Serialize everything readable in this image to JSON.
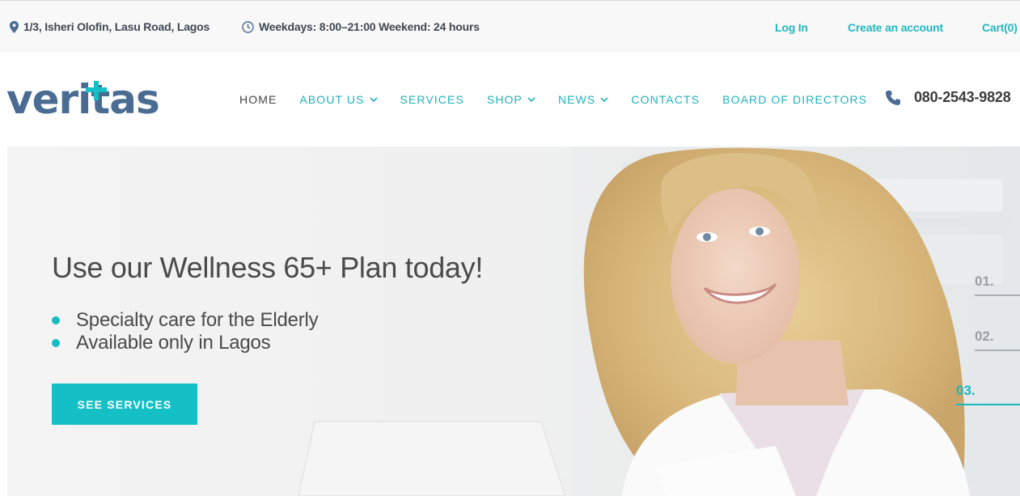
{
  "topbar": {
    "address": "1/3, Isheri Olofin, Lasu Road, Lagos",
    "hours": "Weekdays: 8:00–21:00 Weekend: 24 hours",
    "login": "Log In",
    "create_account": "Create an account",
    "cart": "Cart(0)"
  },
  "header": {
    "logo_text": "veritas",
    "nav": [
      "HOME",
      "ABOUT US",
      "SERVICES",
      "SHOP",
      "NEWS",
      "CONTACTS",
      "BOARD OF DIRECTORS"
    ],
    "phone": "080-2543-9828"
  },
  "hero": {
    "title": "Use our Wellness 65+ Plan today!",
    "bullets": [
      "Specialty care for the Elderly",
      "Available only in Lagos"
    ],
    "cta": "SEE SERVICES",
    "slides": [
      "01.",
      "02.",
      "03."
    ],
    "active_slide": "03."
  },
  "colors": {
    "accent": "#14c0c6",
    "logo_blue": "#4a6c93",
    "nav_text": "#21b2bc",
    "dark_text": "#4a4a4a"
  },
  "icons": [
    "map-pin-icon",
    "clock-icon",
    "chevron-down-icon",
    "phone-icon",
    "logo-cross-icon"
  ]
}
